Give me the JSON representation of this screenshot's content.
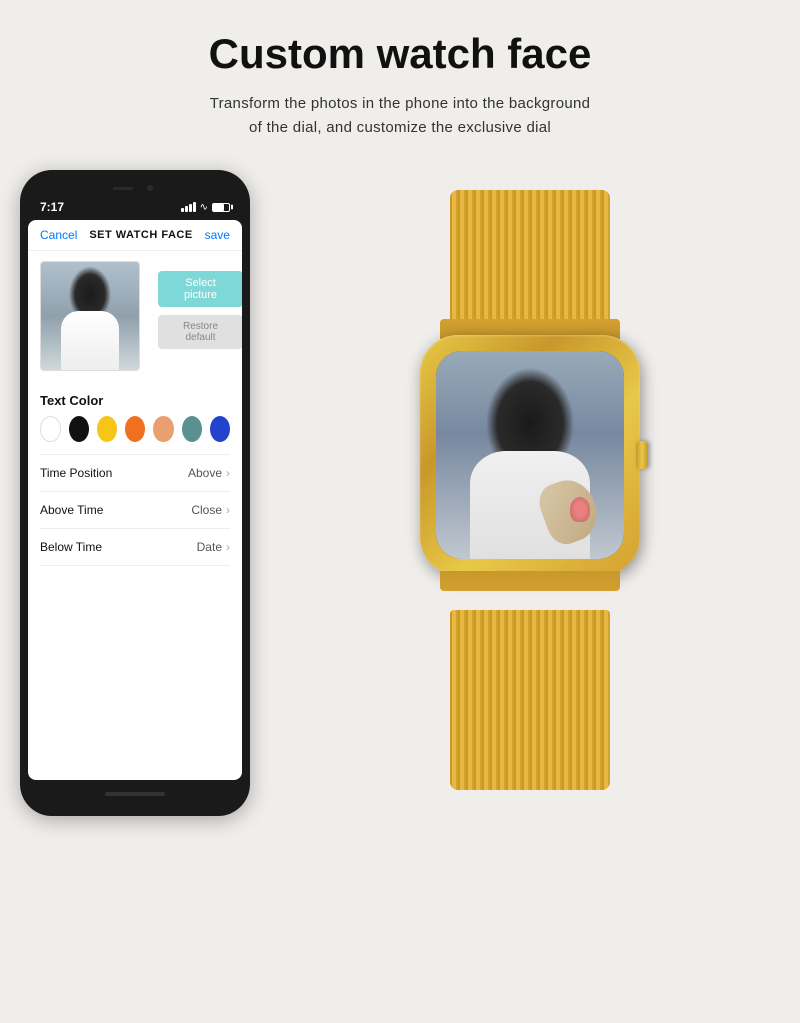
{
  "page": {
    "title": "Custom watch face",
    "subtitle_line1": "Transform the photos in the phone into the background",
    "subtitle_line2": "of the dial, and customize the exclusive dial"
  },
  "phone": {
    "status_time": "7:17",
    "nav": {
      "cancel": "Cancel",
      "title": "SET WATCH FACE",
      "save": "save"
    },
    "buttons": {
      "select": "Select picture",
      "restore": "Restore default"
    },
    "text_color_label": "Text Color",
    "colors": [
      {
        "name": "white",
        "class": "swatch-white"
      },
      {
        "name": "black",
        "class": "swatch-black"
      },
      {
        "name": "yellow",
        "class": "swatch-yellow"
      },
      {
        "name": "orange",
        "class": "swatch-orange"
      },
      {
        "name": "light-orange",
        "class": "swatch-lightorange"
      },
      {
        "name": "teal",
        "class": "swatch-teal"
      },
      {
        "name": "blue",
        "class": "swatch-blue"
      }
    ],
    "settings": [
      {
        "label": "Time Position",
        "value": "Above"
      },
      {
        "label": "Above Time",
        "value": "Close"
      },
      {
        "label": "Below Time",
        "value": "Date"
      }
    ]
  },
  "icons": {
    "chevron": "›",
    "wifi": "▲",
    "signal": "|||"
  }
}
